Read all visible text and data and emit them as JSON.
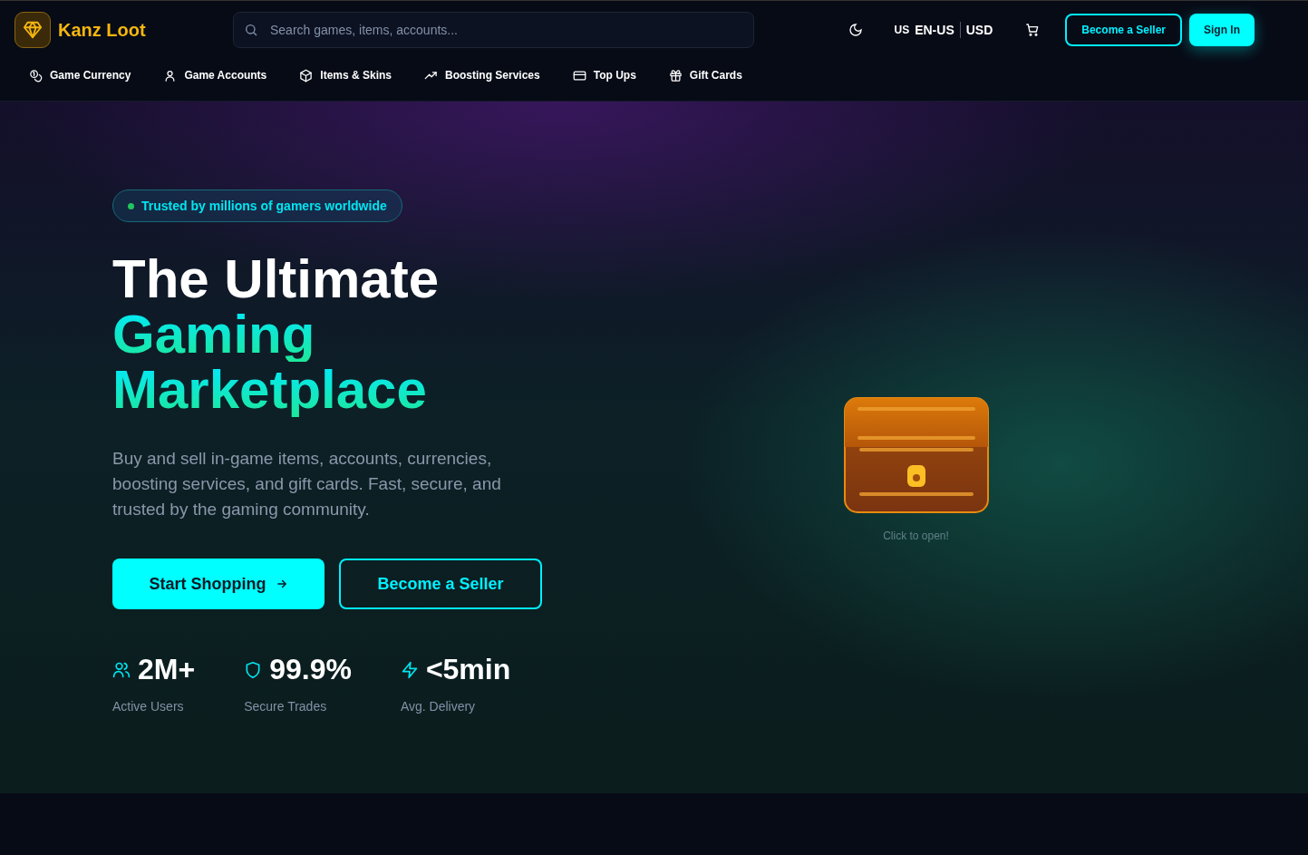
{
  "brand": {
    "name": "Kanz Loot"
  },
  "search": {
    "placeholder": "Search games, items, accounts..."
  },
  "locale": {
    "flag": "US",
    "language": "EN-US",
    "currency": "USD"
  },
  "header_buttons": [
    {
      "label": "Become a Seller",
      "kind": "outline"
    },
    {
      "label": "Sign In",
      "kind": "solid"
    }
  ],
  "nav": [
    {
      "label": "Game Currency",
      "kind": "coins"
    },
    {
      "label": "Game Accounts",
      "kind": "user"
    },
    {
      "label": "Items & Skins",
      "kind": "box"
    },
    {
      "label": "Boosting Services",
      "kind": "trend"
    },
    {
      "label": "Top Ups",
      "kind": "card"
    },
    {
      "label": "Gift Cards",
      "kind": "gift"
    }
  ],
  "hero": {
    "badge": "Trusted by millions of gamers worldwide",
    "title_lines": [
      {
        "text": "The Ultimate",
        "kind": "plain"
      },
      {
        "text": "Gaming",
        "kind": "accent"
      },
      {
        "text": "Marketplace",
        "kind": "accent"
      }
    ],
    "description": "Buy and sell in-game items, accounts, currencies, boosting services, and gift cards. Fast, secure, and trusted by the gaming community.",
    "buttons": [
      {
        "label": "Start Shopping",
        "kind": "solid"
      },
      {
        "label": "Become a Seller",
        "kind": "outline"
      }
    ],
    "stats": [
      {
        "value": "2M+",
        "label": "Active Users",
        "kind": "users"
      },
      {
        "value": "99.9%",
        "label": "Secure Trades",
        "kind": "shield"
      },
      {
        "value": "<5min",
        "label": "Avg. Delivery",
        "kind": "bolt"
      }
    ],
    "chest_hint": "Click to open!"
  }
}
